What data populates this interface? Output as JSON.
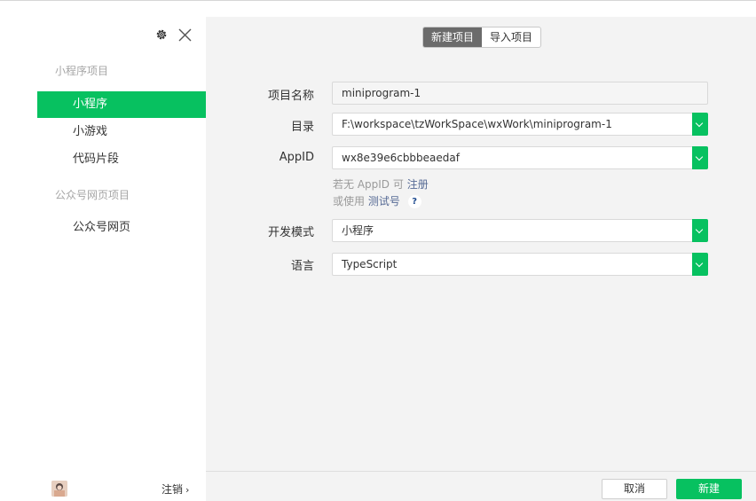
{
  "colors": {
    "accent": "#07c160",
    "link": "#576b95",
    "panel": "#f3f3f3"
  },
  "sidebar": {
    "icons": {
      "settings": "gear-icon",
      "close": "close-icon"
    },
    "section_miniprogram": "小程序项目",
    "section_official": "公众号网页项目",
    "items": [
      {
        "label": "小程序",
        "active": true
      },
      {
        "label": "小游戏",
        "active": false
      },
      {
        "label": "代码片段",
        "active": false
      },
      {
        "label": "公众号网页",
        "active": false
      }
    ],
    "logout_label": "注销",
    "logout_icon": "chevron-right-icon"
  },
  "main": {
    "tabs": [
      {
        "label": "新建项目",
        "active": true
      },
      {
        "label": "导入项目",
        "active": false
      }
    ],
    "form": {
      "project_name_label": "项目名称",
      "project_name_value": "miniprogram-1",
      "directory_label": "目录",
      "directory_value": "F:\\workspace\\tzWorkSpace\\wxWork\\miniprogram-1",
      "appid_label": "AppID",
      "appid_value": "wx8e39e6cbbbeaedaf",
      "hint1_prefix": "若无 AppID 可",
      "hint1_link": "注册",
      "hint2_prefix": "或使用",
      "hint2_link": "测试号",
      "help_icon": "?",
      "mode_label": "开发模式",
      "mode_value": "小程序",
      "language_label": "语言",
      "language_value": "TypeScript"
    },
    "footer": {
      "cancel_label": "取消",
      "create_label": "新建"
    }
  }
}
